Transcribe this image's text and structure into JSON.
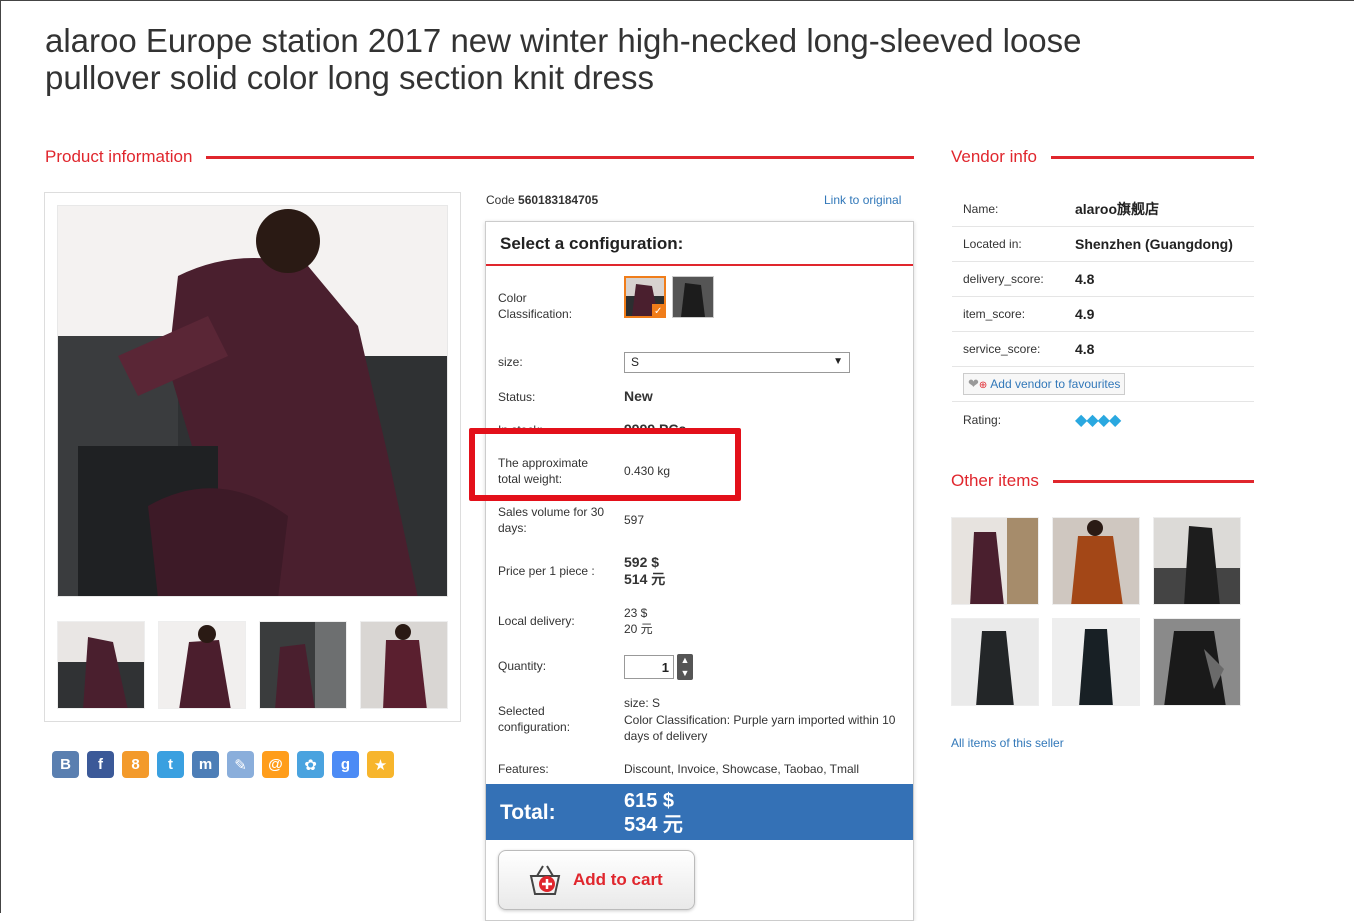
{
  "title": "alaroo Europe station 2017 new winter high-necked long-sleeved loose pullover solid color long section knit dress",
  "product_section": "Product information",
  "vendor_section": "Vendor info",
  "other_section": "Other items",
  "code_label": "Code",
  "code_value": "560183184705",
  "link_original": "Link to original",
  "config_title": "Select a configuration:",
  "config": {
    "color_label": "Color Classification:",
    "size_label": "size:",
    "size_value": "S",
    "status_label": "Status:",
    "status_value": "New",
    "stock_label": "In stock:",
    "stock_value": "9999 PCs",
    "weight_label": "The approximate total weight:",
    "weight_value": "0.430 kg",
    "sales_label": "Sales volume for 30 days:",
    "sales_value": "597",
    "price_label": "Price per 1 piece :",
    "price_usd": "592 $",
    "price_cny": "514 元",
    "delivery_label": "Local delivery:",
    "delivery_usd": "23 $",
    "delivery_cny": "20 元",
    "quantity_label": "Quantity:",
    "quantity_value": "1",
    "selected_label": "Selected configuration:",
    "selected_size": "size: S",
    "selected_color": "Color Classification: Purple yarn imported within 10 days of delivery",
    "features_label": "Features:",
    "features_value": "Discount, Invoice, Showcase, Taobao, Tmall",
    "total_label": "Total:",
    "total_usd": "615 $",
    "total_cny": "534 元",
    "add_to_cart": "Add to cart"
  },
  "vendor": {
    "name_label": "Name:",
    "name_value": "alaroo旗舰店",
    "located_label": "Located in:",
    "located_value": "Shenzhen (Guangdong)",
    "delivery_label": "delivery_score:",
    "delivery_value": "4.8",
    "item_label": "item_score:",
    "item_value": "4.9",
    "service_label": "service_score:",
    "service_value": "4.8",
    "fav_button": "Add vendor to favourites",
    "rating_label": "Rating:"
  },
  "all_items": "All items of this seller",
  "share_icons": [
    "vk-icon",
    "facebook-icon",
    "odnoklassniki-icon",
    "twitter-icon",
    "moimir-icon",
    "livejournal-icon",
    "mail-icon",
    "settings-icon",
    "google-plus-icon",
    "star-icon"
  ],
  "colors": {
    "accent": "#e0262d",
    "total_bg": "#3471b6",
    "link": "#3278b9",
    "highlight": "#e3101a"
  }
}
